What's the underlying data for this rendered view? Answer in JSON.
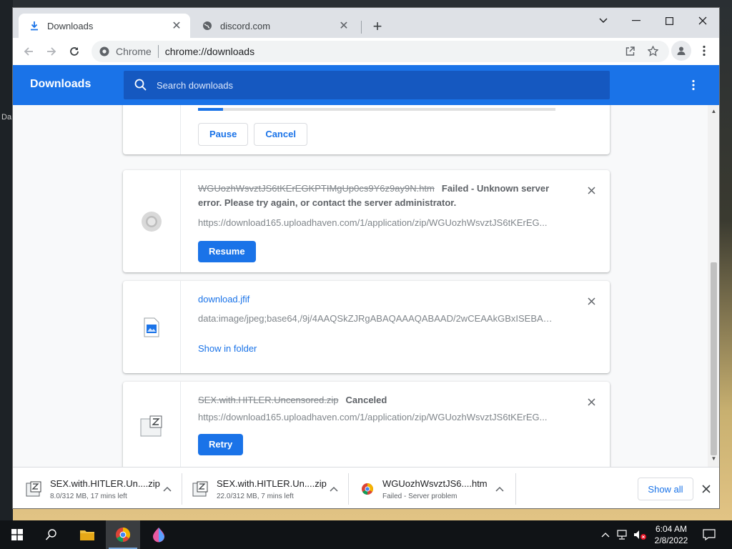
{
  "desktop": {
    "edge_label": "Da"
  },
  "browser": {
    "tabs": [
      {
        "title": "Downloads",
        "icon": "download-icon",
        "active": true
      },
      {
        "title": "discord.com",
        "icon": "globe-icon",
        "active": false
      }
    ],
    "omnibox": {
      "site_label": "Chrome",
      "url": "chrome://downloads"
    }
  },
  "downloads_page": {
    "title": "Downloads",
    "search_placeholder": "Search downloads",
    "progress": 0.07,
    "items": [
      {
        "pause_label": "Pause",
        "cancel_label": "Cancel"
      },
      {
        "filename": "WGUozhWsvztJS6tKErEGKPTIMgUp0cs9Y6z9ay9N.htm",
        "status": "Failed - Unknown server error. Please try again, or contact the server administrator.",
        "url": "https://download165.uploadhaven.com/1/application/zip/WGUozhWsvztJS6tKErEG...",
        "action_label": "Resume"
      },
      {
        "filename": "download.jfif",
        "url": "data:image/jpeg;base64,/9j/4AAQSkZJRgABAQAAAQABAAD/2wCEAAkGBxISEBAQE...",
        "action_label": "Show in folder"
      },
      {
        "filename": "SEX.with.HITLER.Uncensored.zip",
        "status": "Canceled",
        "url": "https://download165.uploadhaven.com/1/application/zip/WGUozhWsvztJS6tKErEG...",
        "action_label": "Retry"
      }
    ]
  },
  "shelf": {
    "items": [
      {
        "name": "SEX.with.HITLER.Un....zip",
        "status": "8.0/312 MB, 17 mins left",
        "icon": "zip-file-icon"
      },
      {
        "name": "SEX.with.HITLER.Un....zip",
        "status": "22.0/312 MB, 7 mins left",
        "icon": "zip-file-icon"
      },
      {
        "name": "WGUozhWsvztJS6....htm",
        "status": "Failed - Server problem",
        "icon": "chrome-icon"
      }
    ],
    "show_all_label": "Show all"
  },
  "taskbar": {
    "time": "6:04 AM",
    "date": "2/8/2022"
  },
  "colors": {
    "accent": "#1a73e8",
    "header_search": "#1558c0"
  }
}
